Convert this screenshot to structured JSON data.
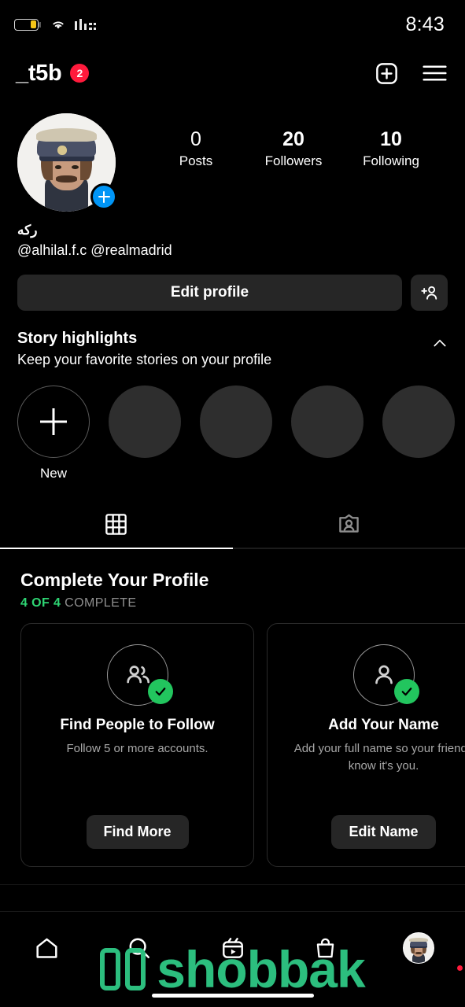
{
  "statusbar": {
    "time": "8:43",
    "battery_icon": "battery-low-icon",
    "battery_level_pct": 28,
    "wifi_icon": "wifi-icon",
    "signal_icon": "cellular-signal-icon"
  },
  "header": {
    "username": "_t5b",
    "badge_count": "2",
    "create_icon": "plus-square-icon",
    "menu_icon": "hamburger-menu-icon"
  },
  "profile": {
    "avatar_name": "profile-avatar",
    "add_story_icon": "plus-icon",
    "stats": [
      {
        "value": "0",
        "label": "Posts"
      },
      {
        "value": "20",
        "label": "Followers"
      },
      {
        "value": "10",
        "label": "Following"
      }
    ],
    "bio_name": "ركه",
    "bio_line": "@alhilal.f.c @realmadrid"
  },
  "actions": {
    "edit_profile_label": "Edit profile",
    "add_user_icon": "add-person-icon"
  },
  "highlights": {
    "title": "Story highlights",
    "subtitle": "Keep your favorite stories on your profile",
    "collapse_icon": "chevron-up-icon",
    "new_label": "New",
    "placeholder_count": 4
  },
  "tabs": [
    {
      "icon": "grid-icon",
      "active": true
    },
    {
      "icon": "tagged-icon",
      "active": false
    }
  ],
  "complete_profile": {
    "title": "Complete Your Profile",
    "count_text": "4 OF 4",
    "complete_text": "COMPLETE",
    "count_color": "#2ED573",
    "cards": [
      {
        "icon": "people-icon",
        "check_icon": "check-circle-icon",
        "title": "Find People to Follow",
        "desc": "Follow 5 or more accounts.",
        "button": "Find More"
      },
      {
        "icon": "person-icon",
        "check_icon": "check-circle-icon",
        "title": "Add Your Name",
        "desc": "Add your full name so your friends know it's you.",
        "button": "Edit Name"
      }
    ]
  },
  "bottomnav": {
    "items": [
      {
        "icon": "home-icon",
        "name": "nav-home"
      },
      {
        "icon": "search-icon",
        "name": "nav-search"
      },
      {
        "icon": "reels-icon",
        "name": "nav-reels"
      },
      {
        "icon": "shop-icon",
        "name": "nav-shop"
      },
      {
        "icon": "avatar-icon",
        "name": "nav-profile"
      }
    ]
  },
  "watermark": {
    "text": "shobbak",
    "color": "#2CBE7E"
  }
}
